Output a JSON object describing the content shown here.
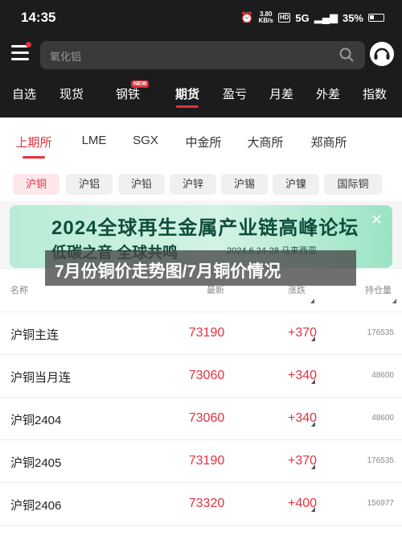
{
  "status_bar": {
    "time": "14:35",
    "speed_value": "3.80",
    "speed_unit": "KB/s",
    "hd": "HD",
    "network": "5G",
    "battery": "35%"
  },
  "search": {
    "placeholder": "氧化铝"
  },
  "nav": {
    "items": [
      "自选",
      "现货",
      "钢铁",
      "期货",
      "盈亏",
      "月差",
      "外差",
      "指数"
    ],
    "active": "期货",
    "badge": "NEW"
  },
  "exchanges": {
    "items": [
      "上期所",
      "LME",
      "SGX",
      "中金所",
      "大商所",
      "郑商所"
    ],
    "active": "上期所"
  },
  "metals": {
    "items": [
      "沪铜",
      "沪铝",
      "沪铅",
      "沪锌",
      "沪锡",
      "沪镍",
      "国际铜"
    ],
    "active": "沪铜"
  },
  "banner": {
    "title": "2024全球再生金属产业链高峰论坛",
    "subtitle": "低碳之音 全球共鸣",
    "date_location": "2024.6.24-28 马来西亚",
    "close": "✕"
  },
  "overlay": {
    "caption": "7月份铜价走势图/7月铜价情况"
  },
  "table": {
    "columns": [
      "名称",
      "最新",
      "涨跌",
      "持仓量"
    ],
    "rows": [
      {
        "name": "沪铜主连",
        "price": "73190",
        "change": "+370",
        "open_interest": "176535"
      },
      {
        "name": "沪铜当月连",
        "price": "73060",
        "change": "+340",
        "open_interest": "48600"
      },
      {
        "name": "沪铜2404",
        "price": "73060",
        "change": "+340",
        "open_interest": "48600"
      },
      {
        "name": "沪铜2405",
        "price": "73190",
        "change": "+370",
        "open_interest": "176535"
      },
      {
        "name": "沪铜2406",
        "price": "73320",
        "change": "+400",
        "open_interest": "156977"
      }
    ]
  },
  "colors": {
    "accent": "#e2323f",
    "header_bg": "#1c1c1e"
  }
}
